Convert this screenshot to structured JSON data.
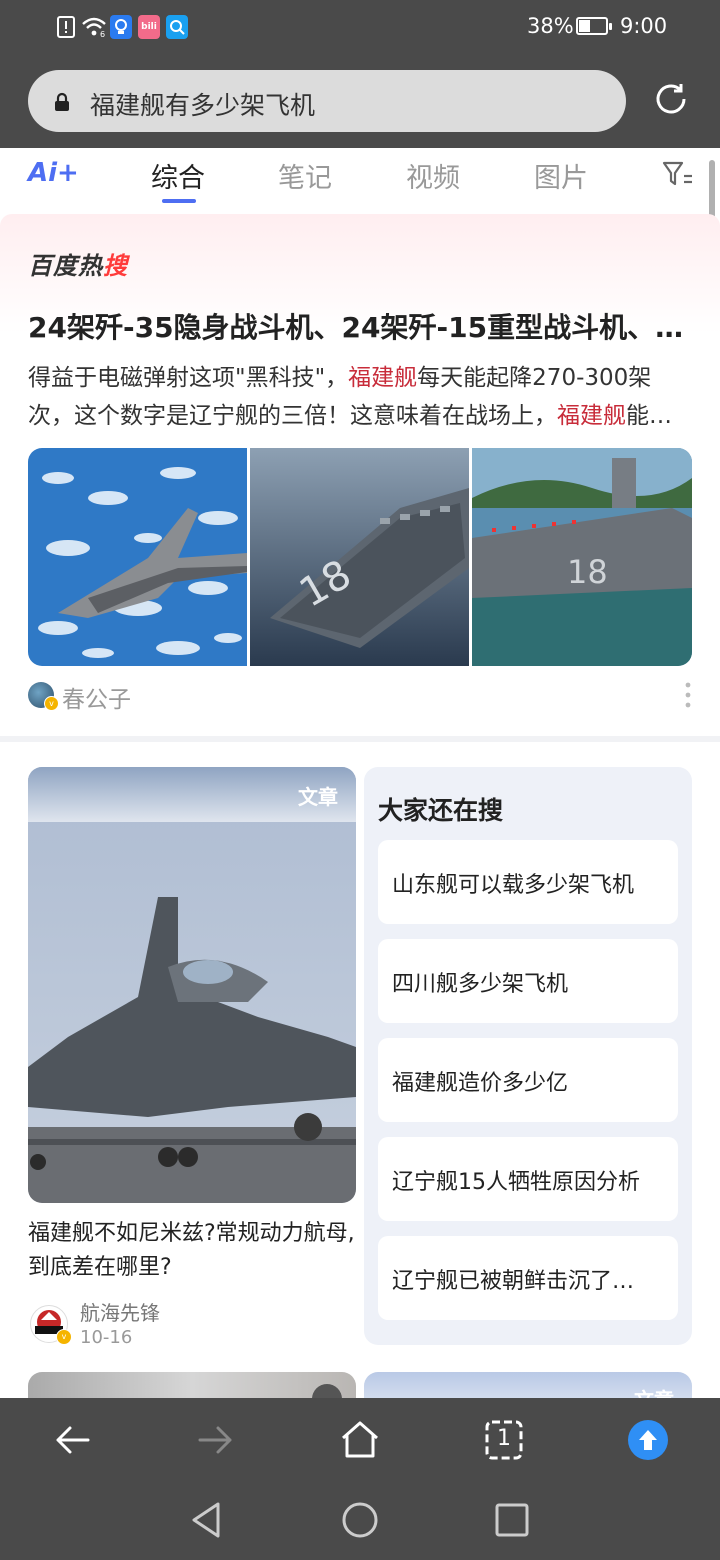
{
  "status_bar": {
    "battery_percent": "38%",
    "battery_level": 0.38,
    "time": "9:00",
    "notification_icons": [
      "alert-icon",
      "wifi-icon",
      "lightbulb-icon",
      "bilibili-icon",
      "search-app-icon"
    ]
  },
  "address_bar": {
    "url_text": "福建舰有多少架飞机"
  },
  "tabs": [
    {
      "label": "综合",
      "active": true
    },
    {
      "label": "笔记",
      "active": false
    },
    {
      "label": "视频",
      "active": false
    },
    {
      "label": "图片",
      "active": false
    }
  ],
  "ai_label": "Ai+",
  "hot_search": {
    "brand_prefix": "百度热",
    "brand_suffix": "搜",
    "title": "24架歼-35隐身战斗机、24架歼-15重型战斗机、…",
    "snippet_parts": [
      {
        "text": "得益于电磁弹射这项\"黑科技\"，",
        "highlight": false
      },
      {
        "text": "福建舰",
        "highlight": true
      },
      {
        "text": "每天能起降270-300架次，这个数字是辽宁舰的三倍！这意味着在战场上，",
        "highlight": false
      },
      {
        "text": "福建舰",
        "highlight": true
      },
      {
        "text": "能…",
        "highlight": false
      }
    ],
    "source_name": "春公子"
  },
  "article_card": {
    "tag": "文章",
    "title": "福建舰不如尼米兹?常规动力航母,到底差在哪里?",
    "author": "航海先锋",
    "date": "10-16"
  },
  "related_searches": {
    "title": "大家还在搜",
    "items": [
      "山东舰可以载多少架飞机",
      "四川舰多少架飞机",
      "福建舰造价多少亿",
      "辽宁舰15人牺牲原因分析",
      "辽宁舰已被朝鲜击沉了…"
    ]
  },
  "peek_card": {
    "tag": "文章"
  },
  "toolbar": {
    "tab_count": "1"
  },
  "colors": {
    "accent_blue": "#4e6ef2",
    "highlight_red": "#c82c3a",
    "chrome_gray": "#4a4a4a"
  }
}
